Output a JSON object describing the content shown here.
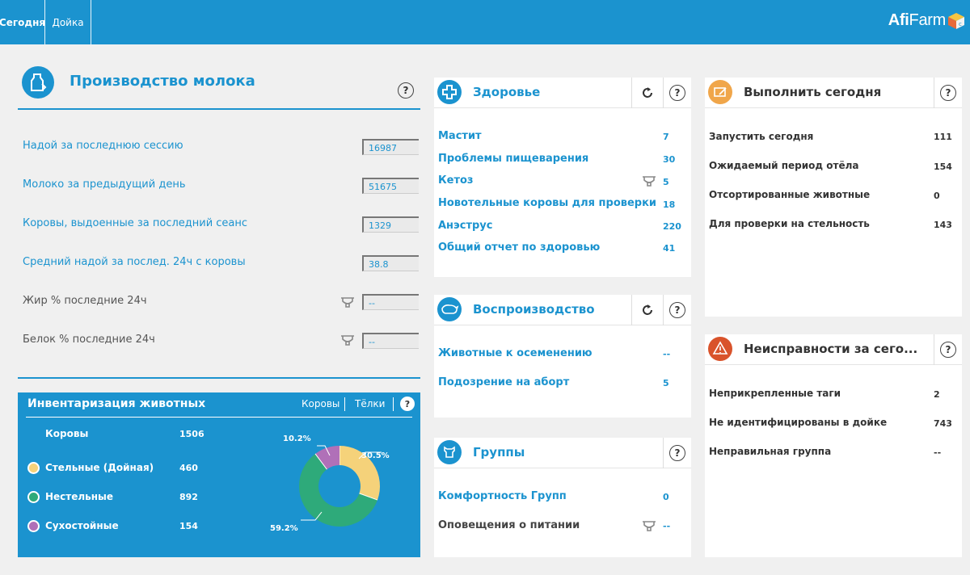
{
  "topbar": {
    "tabs": [
      {
        "label": "Сегодня",
        "active": true
      },
      {
        "label": "Дойка",
        "active": false
      }
    ],
    "logo": {
      "bold": "Afi",
      "light": "Farm"
    }
  },
  "milk": {
    "title": "Производство молока",
    "help": "?",
    "rows": [
      {
        "label": "Надой за последнюю сессию",
        "value": "16987"
      },
      {
        "label": "Молоко за предыдущий день",
        "value": "51675"
      },
      {
        "label": "Коровы, выдоенные за последний сеанс",
        "value": "1329"
      },
      {
        "label": "Средний надой за послед. 24ч с коровы",
        "value": "38.8"
      },
      {
        "label": "Жир % последние 24ч",
        "value": "--"
      },
      {
        "label": "Белок % последние 24ч",
        "value": "--"
      }
    ]
  },
  "inventory": {
    "title": "Инвентаризация животных",
    "tabs": [
      "Коровы",
      "Тёлки"
    ],
    "help": "?",
    "total": {
      "label": "Коровы",
      "value": "1506"
    },
    "items": [
      {
        "label": "Стельные (Дойная)",
        "value": "460",
        "color": "#f5d27a"
      },
      {
        "label": "Нестельные",
        "value": "892",
        "color": "#2eaa7a"
      },
      {
        "label": "Сухостойные",
        "value": "154",
        "color": "#b070b8"
      }
    ],
    "percentages": [
      "30.5%",
      "59.2%",
      "10.2%"
    ]
  },
  "chart_data": {
    "type": "pie",
    "categories": [
      "Стельные (Дойная)",
      "Нестельные",
      "Сухостойные"
    ],
    "values": [
      460,
      892,
      154
    ],
    "labels": [
      "30.5%",
      "59.2%",
      "10.2%"
    ],
    "colors": [
      "#f5d27a",
      "#2eaa7a",
      "#b070b8"
    ]
  },
  "health": {
    "title": "Здоровье",
    "help": "?",
    "rows": [
      {
        "label": "Мастит",
        "value": "7"
      },
      {
        "label": "Проблемы пищеварения",
        "value": "30"
      },
      {
        "label": "Кетоз",
        "value": "5"
      },
      {
        "label": "Новотельные коровы для проверки",
        "value": "18"
      },
      {
        "label": "Анэструс",
        "value": "220"
      },
      {
        "label": "Общий отчет по здоровью",
        "value": "41"
      }
    ]
  },
  "reproduction": {
    "title": "Воспроизводство",
    "help": "?",
    "rows": [
      {
        "label": "Животные к осеменению",
        "value": "--"
      },
      {
        "label": "Подозрение на аборт",
        "value": "5"
      }
    ]
  },
  "groups": {
    "title": "Группы",
    "help": "?",
    "rows": [
      {
        "label": "Комфортность Групп",
        "value": "0"
      },
      {
        "label": "Оповещения о питании",
        "value": "--"
      }
    ]
  },
  "todo": {
    "title": "Выполнить сегодня",
    "help": "?",
    "rows": [
      {
        "label": "Запустить сегодня",
        "value": "111"
      },
      {
        "label": "Ожидаемый период отёла",
        "value": "154"
      },
      {
        "label": "Отсортированные животные",
        "value": "0"
      },
      {
        "label": "Для проверки на стельность",
        "value": "143"
      }
    ]
  },
  "faults": {
    "title": "Неисправности за сего...",
    "help": "?",
    "rows": [
      {
        "label": "Неприкрепленные таги",
        "value": "2"
      },
      {
        "label": "Не идентифицированы в дойке",
        "value": "743"
      },
      {
        "label": "Неправильная группа",
        "value": "--"
      }
    ]
  },
  "colors": {
    "accent": "#1b93cf",
    "todo_icon": "#f0a64a",
    "fault_icon": "#d9532b"
  }
}
